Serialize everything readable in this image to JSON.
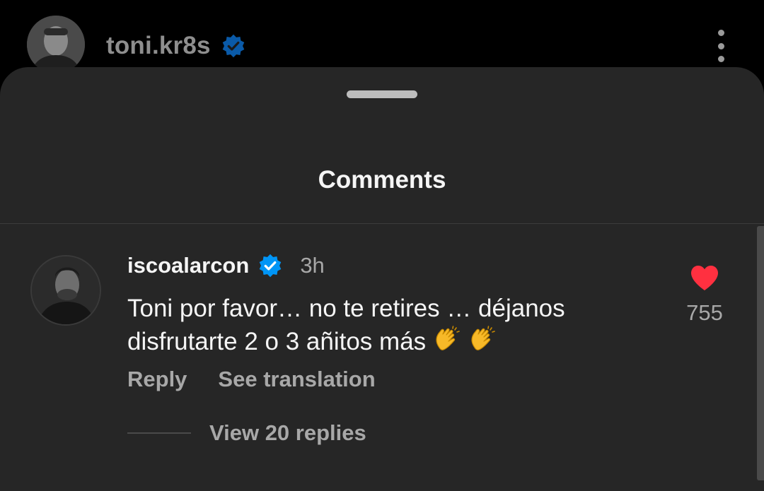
{
  "header": {
    "username": "toni.kr8s",
    "verified_icon": "verified-badge-icon",
    "more_icon": "more-vertical-icon"
  },
  "sheet": {
    "title": "Comments"
  },
  "comment": {
    "username": "iscoalarcon",
    "time": "3h",
    "text_line1": "Toni por favor… no te retires … déjanos",
    "text_line2": "disfrutarte 2 o 3 añitos más",
    "emoji": "clapping-hands",
    "reply_label": "Reply",
    "translate_label": "See translation",
    "like_count": "755",
    "liked": true,
    "view_replies_label": "View 20 replies"
  },
  "colors": {
    "sheet_bg": "#262626",
    "verified_blue": "#0095f6",
    "like_red": "#ff3040",
    "secondary_text": "#a8a8a8"
  }
}
